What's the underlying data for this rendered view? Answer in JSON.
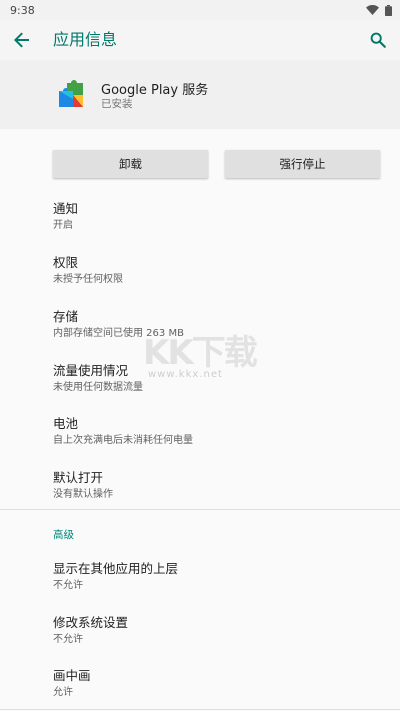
{
  "status_bar": {
    "time": "9:38"
  },
  "app_bar": {
    "title": "应用信息"
  },
  "app": {
    "name": "Google Play 服务",
    "status": "已安装"
  },
  "buttons": {
    "uninstall": "卸载",
    "force_stop": "强行停止"
  },
  "settings": [
    {
      "title": "通知",
      "subtitle": "开启"
    },
    {
      "title": "权限",
      "subtitle": "未授予任何权限"
    },
    {
      "title": "存储",
      "subtitle": "内部存储空间已使用 263 MB"
    },
    {
      "title": "流量使用情况",
      "subtitle": "未使用任何数据流量"
    },
    {
      "title": "电池",
      "subtitle": "自上次充满电后未消耗任何电量"
    },
    {
      "title": "默认打开",
      "subtitle": "没有默认操作"
    }
  ],
  "advanced": {
    "label": "高级",
    "items": [
      {
        "title": "显示在其他应用的上层",
        "subtitle": "不允许"
      },
      {
        "title": "修改系统设置",
        "subtitle": "不允许"
      },
      {
        "title": "画中画",
        "subtitle": "允许"
      }
    ]
  },
  "watermark": {
    "main": "KK下载",
    "url": "www.kkx.net"
  },
  "colors": {
    "accent": "#00796b",
    "background": "#fafafa",
    "header": "#f0f0f0"
  }
}
